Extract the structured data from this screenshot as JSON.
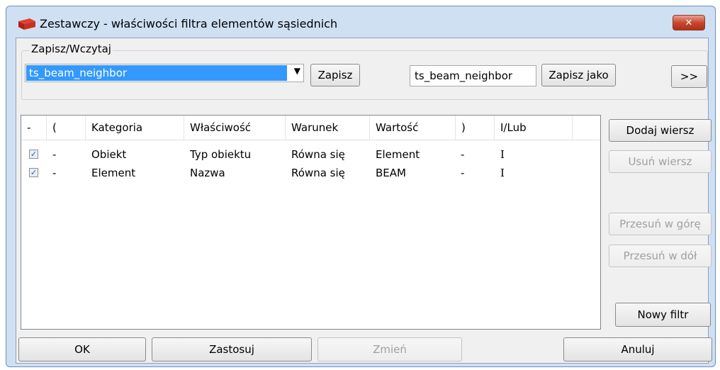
{
  "window": {
    "title": "Zestawczy - właściwości filtra elementów sąsiednich",
    "close_label": "✕"
  },
  "saveload": {
    "legend": "Zapisz/Wczytaj",
    "combo_value": "ts_beam_neighbor",
    "save_label": "Zapisz",
    "saveas_value": "ts_beam_neighbor",
    "saveas_label": "Zapisz jako",
    "more_label": ">>"
  },
  "grid": {
    "headers": [
      "-",
      "(",
      "Kategoria",
      "Właściwość",
      "Warunek",
      "Wartość",
      ")",
      "I/Lub"
    ],
    "rows": [
      {
        "checked": true,
        "open": "-",
        "category": "Obiekt",
        "property": "Typ obiektu",
        "condition": "Równa się",
        "value": "Element",
        "close": "-",
        "andor": "I"
      },
      {
        "checked": true,
        "open": "-",
        "category": "Element",
        "property": "Nazwa",
        "condition": "Równa się",
        "value": "BEAM",
        "close": "-",
        "andor": "I"
      }
    ]
  },
  "side": {
    "add_row": "Dodaj wiersz",
    "remove_row": "Usuń wiersz",
    "move_up": "Przesuń w górę",
    "move_down": "Przesuń w dół",
    "new_filter": "Nowy filtr"
  },
  "bottom": {
    "ok": "OK",
    "apply": "Zastosuj",
    "modify": "Zmień",
    "cancel": "Anuluj"
  },
  "colors": {
    "selection": "#3399ff",
    "frame": "#cfe0f3",
    "close": "#c7482f"
  }
}
